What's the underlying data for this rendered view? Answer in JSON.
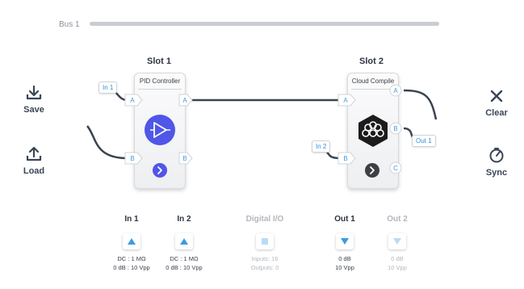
{
  "bus": {
    "label": "Bus 1"
  },
  "actions": {
    "save": {
      "label": "Save",
      "icon": "save-icon"
    },
    "load": {
      "label": "Load",
      "icon": "load-icon"
    },
    "clear": {
      "label": "Clear",
      "icon": "close-icon"
    },
    "sync": {
      "label": "Sync",
      "icon": "gauge-icon"
    }
  },
  "slots": [
    {
      "title": "Slot 1",
      "module": "PID Controller",
      "icon": "amplifier-icon",
      "accent": "#4f56e8",
      "inputs": [
        "A",
        "B"
      ],
      "outputs": [
        "A",
        "B"
      ]
    },
    {
      "title": "Slot 2",
      "module": "Cloud Compile",
      "icon": "cloud-compile-icon",
      "accent": "#1c1c1c",
      "inputs": [
        "A",
        "B"
      ],
      "outputs": [
        "A",
        "B",
        "C"
      ]
    }
  ],
  "tags": {
    "in1": "In 1",
    "in2": "In 2",
    "out1": "Out 1"
  },
  "io": [
    {
      "title": "In 1",
      "line1": "DC : 1 MΩ",
      "line2": "0 dB : 10 Vpp",
      "enabled": true
    },
    {
      "title": "In 2",
      "line1": "DC : 1 MΩ",
      "line2": "0 dB : 10 Vpp",
      "enabled": true
    },
    {
      "title": "Digital I/O",
      "line1": "Inputs: 16",
      "line2": "Outputs: 0",
      "enabled": false
    },
    {
      "title": "Out 1",
      "line1": "0 dB",
      "line2": "10 Vpp",
      "enabled": true
    },
    {
      "title": "Out 2",
      "line1": "0 dB",
      "line2": "10 Vpp",
      "enabled": false
    }
  ],
  "colors": {
    "port": "#3e9be0",
    "wire": "#3b4350",
    "blue_accent": "#4f56e8"
  }
}
